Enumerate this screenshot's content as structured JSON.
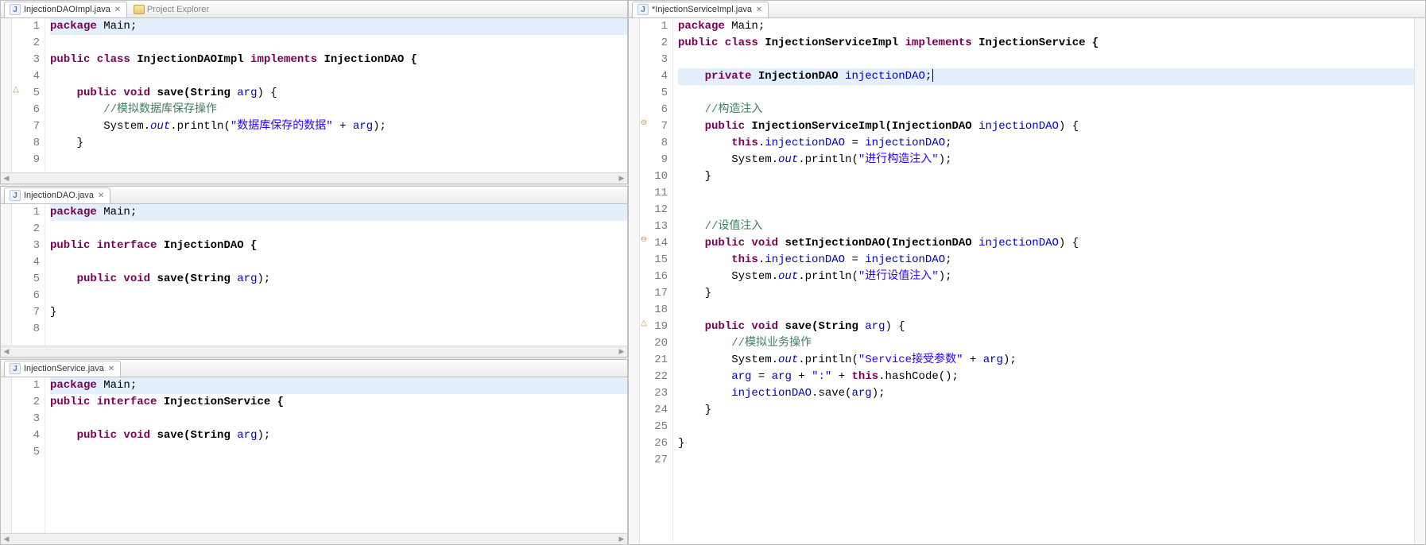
{
  "tabs": {
    "pane1_tab": "InjectionDAOImpl.java",
    "pane1_hidden": "Project Explorer",
    "pane2_tab": "InjectionDAO.java",
    "pane3_tab": "InjectionService.java",
    "pane4_tab": "*InjectionServiceImpl.java"
  },
  "pane1": {
    "lines": [
      {
        "n": 1,
        "hl": "blue",
        "tokens": [
          {
            "t": "package ",
            "c": "kw"
          },
          {
            "t": "Main;"
          }
        ]
      },
      {
        "n": 2,
        "tokens": []
      },
      {
        "n": 3,
        "tokens": [
          {
            "t": "public class ",
            "c": "kw"
          },
          {
            "t": "InjectionDAOImpl ",
            "c": "typ"
          },
          {
            "t": "implements ",
            "c": "kw"
          },
          {
            "t": "InjectionDAO {",
            "c": "typ"
          }
        ]
      },
      {
        "n": 4,
        "tokens": []
      },
      {
        "n": 5,
        "mk": "△",
        "tokens": [
          {
            "t": "    "
          },
          {
            "t": "public void ",
            "c": "kw"
          },
          {
            "t": "save(String ",
            "c": "typ"
          },
          {
            "t": "arg",
            "c": "fld"
          },
          {
            "t": ") {"
          }
        ]
      },
      {
        "n": 6,
        "tokens": [
          {
            "t": "        "
          },
          {
            "t": "//模拟数据库保存操作",
            "c": "cmt"
          }
        ]
      },
      {
        "n": 7,
        "tokens": [
          {
            "t": "        System."
          },
          {
            "t": "out",
            "c": "fld itl"
          },
          {
            "t": ".println("
          },
          {
            "t": "\"数据库保存的数据\"",
            "c": "str"
          },
          {
            "t": " + "
          },
          {
            "t": "arg",
            "c": "fld"
          },
          {
            "t": ");"
          }
        ]
      },
      {
        "n": 8,
        "tokens": [
          {
            "t": "    }"
          }
        ]
      },
      {
        "n": 9,
        "tokens": []
      }
    ]
  },
  "pane2": {
    "lines": [
      {
        "n": 1,
        "hl": "blue",
        "tokens": [
          {
            "t": "package ",
            "c": "kw"
          },
          {
            "t": "Main;"
          }
        ]
      },
      {
        "n": 2,
        "tokens": []
      },
      {
        "n": 3,
        "tokens": [
          {
            "t": "public interface ",
            "c": "kw"
          },
          {
            "t": "InjectionDAO {",
            "c": "typ"
          }
        ]
      },
      {
        "n": 4,
        "tokens": []
      },
      {
        "n": 5,
        "tokens": [
          {
            "t": "    "
          },
          {
            "t": "public void ",
            "c": "kw"
          },
          {
            "t": "save(String ",
            "c": "typ"
          },
          {
            "t": "arg",
            "c": "fld"
          },
          {
            "t": ");"
          }
        ]
      },
      {
        "n": 6,
        "tokens": []
      },
      {
        "n": 7,
        "tokens": [
          {
            "t": "}"
          }
        ]
      },
      {
        "n": 8,
        "tokens": []
      }
    ]
  },
  "pane3": {
    "lines": [
      {
        "n": 1,
        "hl": "blue",
        "tokens": [
          {
            "t": "package ",
            "c": "kw"
          },
          {
            "t": "Main;"
          }
        ]
      },
      {
        "n": 2,
        "tokens": [
          {
            "t": "public interface ",
            "c": "kw"
          },
          {
            "t": "InjectionService {",
            "c": "typ"
          }
        ]
      },
      {
        "n": 3,
        "tokens": []
      },
      {
        "n": 4,
        "tokens": [
          {
            "t": "    "
          },
          {
            "t": "public void ",
            "c": "kw"
          },
          {
            "t": "save(String ",
            "c": "typ"
          },
          {
            "t": "arg",
            "c": "fld"
          },
          {
            "t": ");"
          }
        ]
      },
      {
        "n": 5,
        "tokens": []
      }
    ]
  },
  "pane4": {
    "lines": [
      {
        "n": 1,
        "tokens": [
          {
            "t": "package ",
            "c": "kw"
          },
          {
            "t": "Main;"
          }
        ]
      },
      {
        "n": 2,
        "tokens": [
          {
            "t": "public class ",
            "c": "kw"
          },
          {
            "t": "InjectionServiceImpl ",
            "c": "typ"
          },
          {
            "t": "implements ",
            "c": "kw"
          },
          {
            "t": "InjectionService {",
            "c": "typ"
          }
        ]
      },
      {
        "n": 3,
        "tokens": []
      },
      {
        "n": 4,
        "hl": "blue",
        "tokens": [
          {
            "t": "    "
          },
          {
            "t": "private ",
            "c": "kw"
          },
          {
            "t": "InjectionDAO ",
            "c": "typ"
          },
          {
            "t": "injectionDAO",
            "c": "fld"
          },
          {
            "t": ";"
          },
          {
            "t": "",
            "cur": true
          }
        ]
      },
      {
        "n": 5,
        "tokens": []
      },
      {
        "n": 6,
        "tokens": [
          {
            "t": "    "
          },
          {
            "t": "//构造注入",
            "c": "cmt"
          }
        ]
      },
      {
        "n": 7,
        "mk": "⊖",
        "tokens": [
          {
            "t": "    "
          },
          {
            "t": "public ",
            "c": "kw"
          },
          {
            "t": "InjectionServiceImpl(InjectionDAO ",
            "c": "typ"
          },
          {
            "t": "injectionDAO",
            "c": "fld"
          },
          {
            "t": ") {"
          }
        ]
      },
      {
        "n": 8,
        "tokens": [
          {
            "t": "        "
          },
          {
            "t": "this",
            "c": "kw"
          },
          {
            "t": "."
          },
          {
            "t": "injectionDAO",
            "c": "fld"
          },
          {
            "t": " = "
          },
          {
            "t": "injectionDAO",
            "c": "fld"
          },
          {
            "t": ";"
          }
        ]
      },
      {
        "n": 9,
        "tokens": [
          {
            "t": "        System."
          },
          {
            "t": "out",
            "c": "fld itl"
          },
          {
            "t": ".println("
          },
          {
            "t": "\"进行构造注入\"",
            "c": "str"
          },
          {
            "t": ");"
          }
        ]
      },
      {
        "n": 10,
        "tokens": [
          {
            "t": "    }"
          }
        ]
      },
      {
        "n": 11,
        "tokens": []
      },
      {
        "n": 12,
        "tokens": []
      },
      {
        "n": 13,
        "tokens": [
          {
            "t": "    "
          },
          {
            "t": "//设值注入",
            "c": "cmt"
          }
        ]
      },
      {
        "n": 14,
        "mk": "⊖",
        "tokens": [
          {
            "t": "    "
          },
          {
            "t": "public void ",
            "c": "kw"
          },
          {
            "t": "setInjectionDAO(InjectionDAO ",
            "c": "typ"
          },
          {
            "t": "injectionDAO",
            "c": "fld"
          },
          {
            "t": ") {"
          }
        ]
      },
      {
        "n": 15,
        "tokens": [
          {
            "t": "        "
          },
          {
            "t": "this",
            "c": "kw"
          },
          {
            "t": "."
          },
          {
            "t": "injectionDAO",
            "c": "fld"
          },
          {
            "t": " = "
          },
          {
            "t": "injectionDAO",
            "c": "fld"
          },
          {
            "t": ";"
          }
        ]
      },
      {
        "n": 16,
        "tokens": [
          {
            "t": "        System."
          },
          {
            "t": "out",
            "c": "fld itl"
          },
          {
            "t": ".println("
          },
          {
            "t": "\"进行设值注入\"",
            "c": "str"
          },
          {
            "t": ");"
          }
        ]
      },
      {
        "n": 17,
        "tokens": [
          {
            "t": "    }"
          }
        ]
      },
      {
        "n": 18,
        "tokens": []
      },
      {
        "n": 19,
        "mk": "△",
        "tokens": [
          {
            "t": "    "
          },
          {
            "t": "public void ",
            "c": "kw"
          },
          {
            "t": "save(String ",
            "c": "typ"
          },
          {
            "t": "arg",
            "c": "fld"
          },
          {
            "t": ") {"
          }
        ]
      },
      {
        "n": 20,
        "tokens": [
          {
            "t": "        "
          },
          {
            "t": "//模拟业务操作",
            "c": "cmt"
          }
        ]
      },
      {
        "n": 21,
        "tokens": [
          {
            "t": "        System."
          },
          {
            "t": "out",
            "c": "fld itl"
          },
          {
            "t": ".println("
          },
          {
            "t": "\"Service接受参数\"",
            "c": "str"
          },
          {
            "t": " + "
          },
          {
            "t": "arg",
            "c": "fld"
          },
          {
            "t": ");"
          }
        ]
      },
      {
        "n": 22,
        "tokens": [
          {
            "t": "        "
          },
          {
            "t": "arg",
            "c": "fld"
          },
          {
            "t": " = "
          },
          {
            "t": "arg",
            "c": "fld"
          },
          {
            "t": " + "
          },
          {
            "t": "\":\"",
            "c": "str"
          },
          {
            "t": " + "
          },
          {
            "t": "this",
            "c": "kw"
          },
          {
            "t": ".hashCode();"
          }
        ]
      },
      {
        "n": 23,
        "tokens": [
          {
            "t": "        "
          },
          {
            "t": "injectionDAO",
            "c": "fld"
          },
          {
            "t": ".save("
          },
          {
            "t": "arg",
            "c": "fld"
          },
          {
            "t": ");"
          }
        ]
      },
      {
        "n": 24,
        "tokens": [
          {
            "t": "    }"
          }
        ]
      },
      {
        "n": 25,
        "tokens": []
      },
      {
        "n": 26,
        "tokens": [
          {
            "t": "}"
          }
        ]
      },
      {
        "n": 27,
        "tokens": []
      }
    ]
  }
}
